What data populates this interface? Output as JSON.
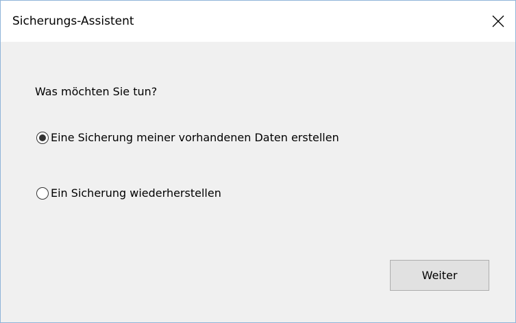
{
  "window": {
    "title": "Sicherungs-Assistent",
    "close_icon": "close-icon"
  },
  "main": {
    "question": "Was möchten Sie tun?",
    "options": [
      {
        "label": "Eine Sicherung meiner vorhandenen Daten erstellen",
        "selected": true
      },
      {
        "label": "Ein Sicherung wiederherstellen",
        "selected": false
      }
    ],
    "next_label": "Weiter"
  },
  "colors": {
    "window_border": "#8fb4d8",
    "background": "#f0f0f0",
    "titlebar": "#ffffff",
    "button_face": "#e1e1e1"
  }
}
